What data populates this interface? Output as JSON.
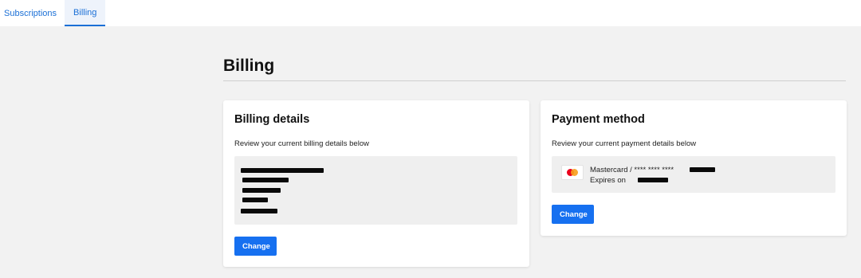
{
  "tabs": [
    {
      "label": "Subscriptions",
      "active": false
    },
    {
      "label": "Billing",
      "active": true
    }
  ],
  "page": {
    "title": "Billing"
  },
  "billing_details": {
    "heading": "Billing details",
    "description": "Review your current billing details below",
    "content": "redacted",
    "change_label": "Change"
  },
  "payment_method": {
    "heading": "Payment method",
    "description": "Review your current payment details below",
    "card_icon": "mastercard-icon",
    "card_text": "Mastercard / **** **** ****",
    "expires_text": "Expires on",
    "change_label": "Change"
  },
  "colors": {
    "accent": "#1670f0",
    "tab_text": "#1a6fd6",
    "page_bg": "#f2f2f2",
    "card_bg": "#ffffff"
  }
}
